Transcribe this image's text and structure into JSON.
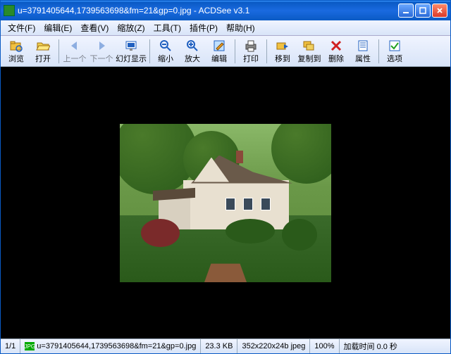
{
  "titlebar": {
    "filename": "u=3791405644,1739563698&fm=21&gp=0.jpg",
    "appname": "ACDSee v3.1"
  },
  "menu": {
    "file": "文件(F)",
    "edit": "编辑(E)",
    "view": "查看(V)",
    "zoom": "缩放(Z)",
    "tools": "工具(T)",
    "plugins": "插件(P)",
    "help": "帮助(H)"
  },
  "toolbar": {
    "browse": "浏览",
    "open": "打开",
    "prev": "上一个",
    "next": "下一个",
    "slideshow": "幻灯显示",
    "zoomout": "缩小",
    "zoomin": "放大",
    "editimg": "编辑",
    "print": "打印",
    "moveto": "移到",
    "copyto": "复制到",
    "delete": "删除",
    "properties": "属性",
    "options": "选项"
  },
  "status": {
    "index": "1/1",
    "badge": "JPG",
    "filename": "u=3791405644,1739563698&fm=21&gp=0.jpg",
    "filesize": "23.3 KB",
    "dimensions": "352x220x24b jpeg",
    "zoom": "100%",
    "loadtime": "加载时间 0.0 秒"
  },
  "icons": {
    "browse": "folder-tree-icon",
    "open": "folder-open-icon",
    "prev": "arrow-left-icon",
    "next": "arrow-right-icon",
    "slideshow": "slideshow-icon",
    "zoomout": "zoom-out-icon",
    "zoomin": "zoom-in-icon",
    "editimg": "pencil-icon",
    "print": "printer-icon",
    "moveto": "folder-move-icon",
    "copyto": "folder-copy-icon",
    "delete": "x-delete-icon",
    "properties": "properties-icon",
    "options": "checkbox-icon"
  },
  "colors": {
    "titlebar_start": "#3a95ff",
    "titlebar_end": "#0a5ac4",
    "close_btn": "#d83a2a",
    "panel_bg": "#d8e4f8",
    "viewport_bg": "#000000"
  }
}
